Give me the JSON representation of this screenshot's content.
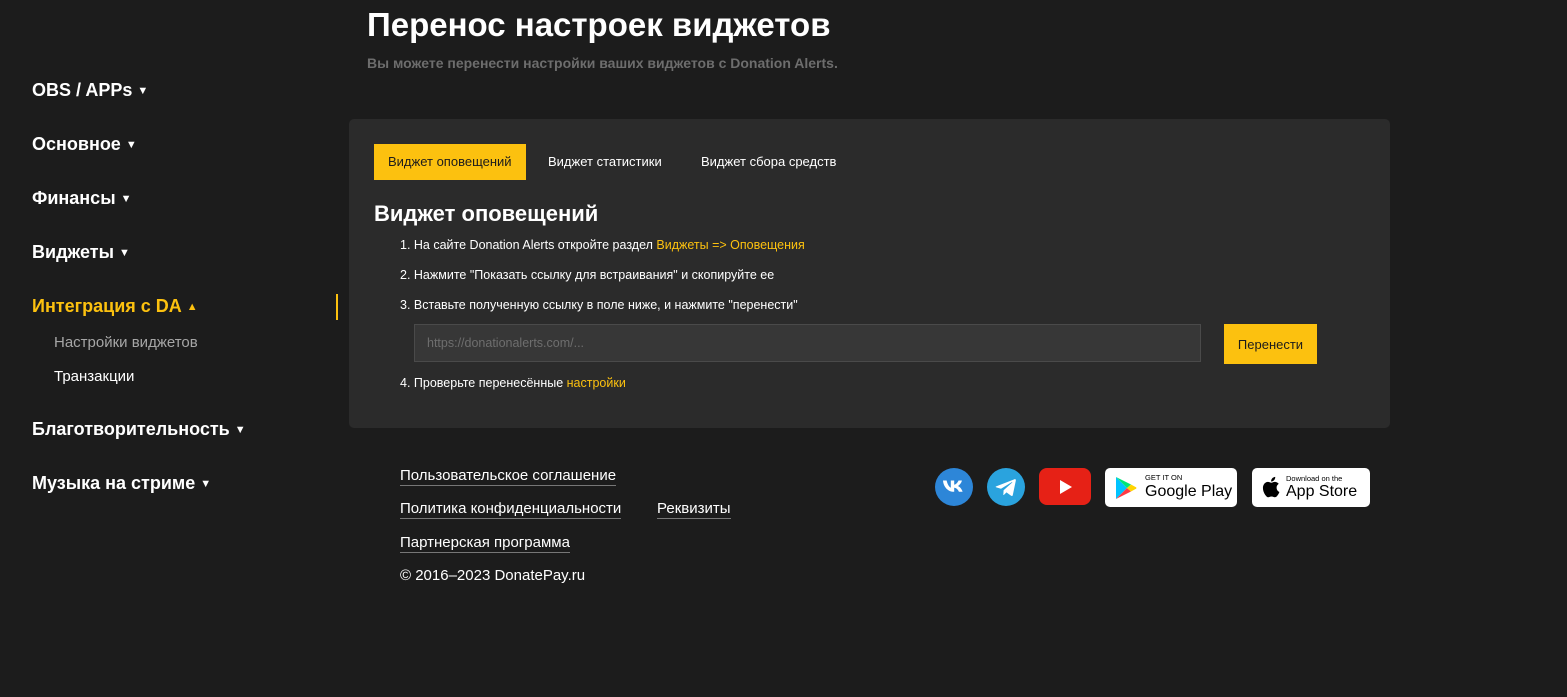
{
  "sidebar": {
    "items": [
      {
        "label": "OBS / APPs",
        "caret": "▼"
      },
      {
        "label": "Основное",
        "caret": "▼"
      },
      {
        "label": "Финансы",
        "caret": "▼"
      },
      {
        "label": "Виджеты",
        "caret": "▼"
      },
      {
        "label": "Интеграция с DA",
        "caret": "▲"
      },
      {
        "label": "Благотворительность",
        "caret": "▼"
      },
      {
        "label": "Музыка на стриме",
        "caret": "▼"
      }
    ],
    "subitems": [
      {
        "label": "Настройки виджетов"
      },
      {
        "label": "Транзакции"
      }
    ]
  },
  "header": {
    "title": "Перенос настроек виджетов",
    "subtitle": "Вы можете перенести настройки ваших виджетов с Donation Alerts."
  },
  "card": {
    "tabs": [
      {
        "label": "Виджет оповещений"
      },
      {
        "label": "Виджет статистики"
      },
      {
        "label": "Виджет сбора средств"
      }
    ],
    "heading": "Виджет оповещений",
    "steps": {
      "step1_text": "1. На сайте Donation Alerts откройте раздел ",
      "step1_link": "Виджеты => Оповещения",
      "step2_text": "2. Нажмите \"Показать ссылку для встраивания\" и скопируйте ее",
      "step3_text": "3. Вставьте полученную ссылку в поле ниже, и нажмите \"перенести\"",
      "step4_text": "4. Проверьте перенесённые ",
      "step4_link": "настройки"
    },
    "input": {
      "placeholder": "https://donationalerts.com/...",
      "value": ""
    },
    "submit_label": "Перенести"
  },
  "footer": {
    "links": {
      "terms": "Пользовательское соглашение",
      "privacy": "Политика конфиденциальности",
      "requisites": "Реквизиты",
      "partner": "Партнерская программа"
    },
    "copyright": "© 2016–2023 DonatePay.ru",
    "social": [
      "vk-icon",
      "telegram-icon",
      "youtube-icon"
    ],
    "stores": {
      "google_small": "GET IT ON",
      "google_big": "Google Play",
      "apple_small": "Download on the",
      "apple_big": "App Store"
    }
  },
  "colors": {
    "accent": "#fcc10f",
    "background": "#1c1c1c",
    "card": "#2b2b2b"
  }
}
